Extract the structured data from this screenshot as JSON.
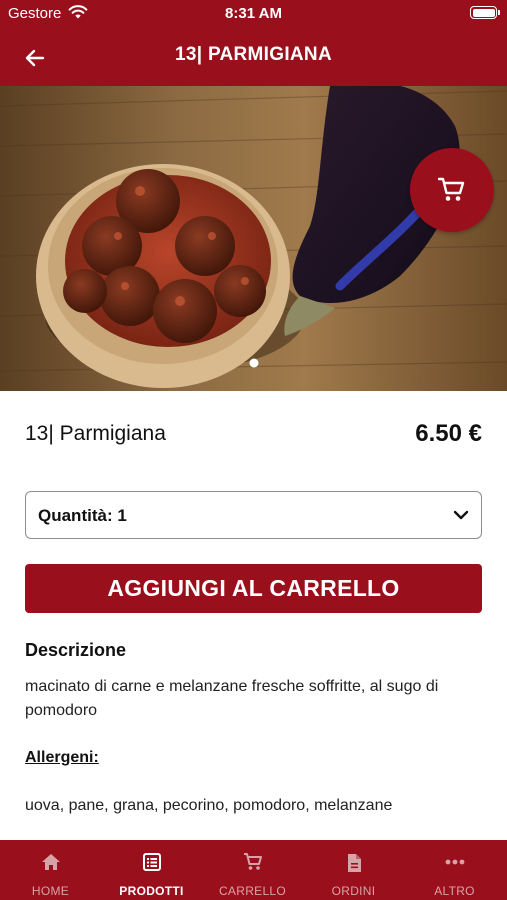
{
  "status_bar": {
    "carrier": "Gestore",
    "time": "8:31 AM"
  },
  "header": {
    "title": "13| PARMIGIANA"
  },
  "hero": {
    "image": "meatballs-tomato-sauce-eggplant-photo",
    "cart_icon": "cart-icon",
    "pager_dots": 1,
    "pager_active": 1
  },
  "product": {
    "name": "13| Parmigiana",
    "price": "6.50 €"
  },
  "quantity": {
    "label": "Quantità: 1"
  },
  "add_button": {
    "label": "AGGIUNGI AL CARRELLO"
  },
  "description": {
    "title": "Descrizione",
    "text": "macinato di carne e melanzane fresche soffritte, al sugo di pomodoro"
  },
  "allergens": {
    "title": "Allergeni:",
    "text": "uova, pane, grana, pecorino, pomodoro, melanzane"
  },
  "tab_bar": {
    "items": [
      {
        "label": "HOME",
        "icon": "home-icon",
        "active": false
      },
      {
        "label": "PRODOTTI",
        "icon": "list-icon",
        "active": true
      },
      {
        "label": "CARRELLO",
        "icon": "cart-icon",
        "active": false
      },
      {
        "label": "ORDINI",
        "icon": "document-icon",
        "active": false
      },
      {
        "label": "ALTRO",
        "icon": "more-icon",
        "active": false
      }
    ]
  },
  "colors": {
    "brand": "#9a0f1c",
    "tab_inactive": "#d8a3a8"
  }
}
